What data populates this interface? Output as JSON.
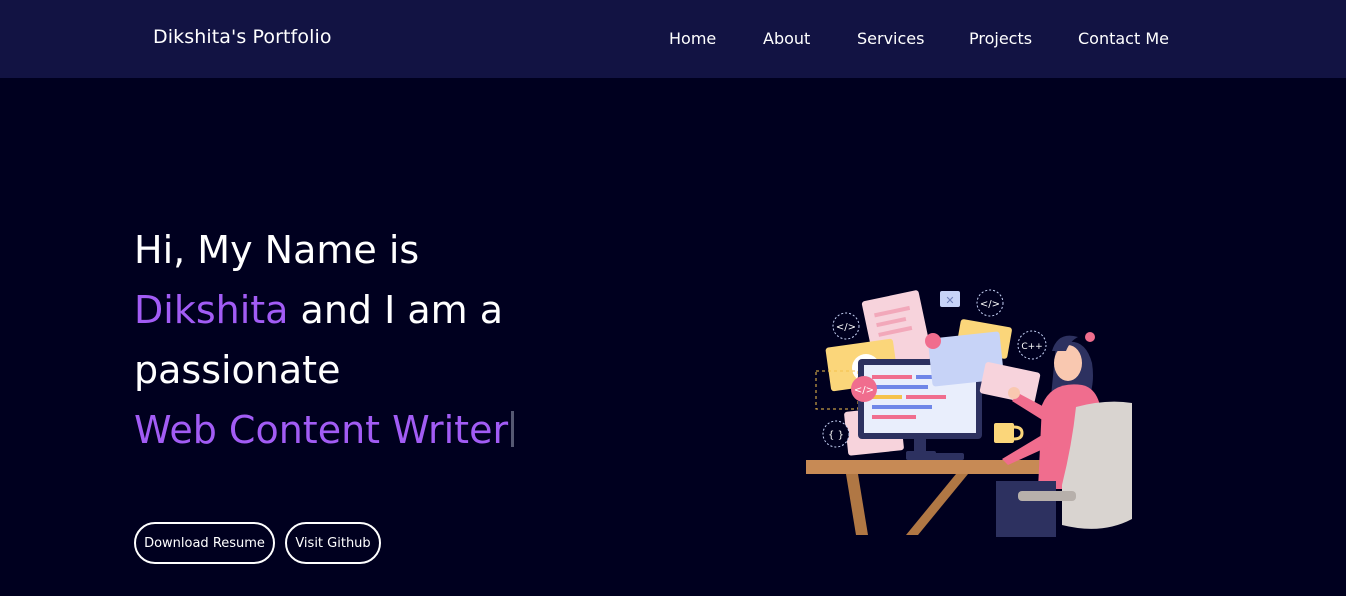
{
  "navbar": {
    "brand": "Dikshita's Portfolio",
    "links": [
      "Home",
      "About",
      "Services",
      "Projects",
      "Contact Me"
    ]
  },
  "hero": {
    "line1": "Hi, My Name is",
    "name": "Dikshita",
    "line2_rest": " and I am a",
    "line3": "passionate",
    "role": "Web Content Writer"
  },
  "buttons": {
    "download": "Download Resume",
    "github": "Visit Github"
  },
  "illustration": {
    "icons": [
      "code-icon",
      "cpp-icon",
      "curly-braces-icon",
      "close-icon"
    ],
    "code_tags": [
      "</>",
      "</>",
      "</>",
      "C++",
      "{ }",
      "✕"
    ]
  },
  "colors": {
    "background": "#00001f",
    "navbar": "#121343",
    "accent": "#a25cf5"
  }
}
